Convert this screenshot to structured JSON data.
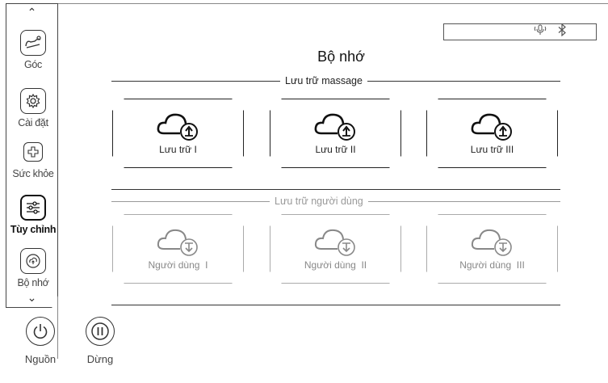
{
  "sidebar": {
    "items": [
      {
        "label": "Góc",
        "icon": "recline-icon"
      },
      {
        "label": "Cài đặt",
        "icon": "gear-icon"
      },
      {
        "label": "Sức khỏe",
        "icon": "health-plus-icon"
      },
      {
        "label": "Tùy chỉnh",
        "icon": "sliders-icon"
      },
      {
        "label": "Bộ nhớ",
        "icon": "memory-cloud-icon"
      }
    ]
  },
  "controls": {
    "power_label": "Nguồn",
    "pause_label": "Dừng"
  },
  "status_bar": {
    "icons": [
      "voice-mic-icon",
      "bluetooth-icon"
    ]
  },
  "page": {
    "title": "Bộ nhớ"
  },
  "storage_section": {
    "label": "Lưu trữ massage",
    "cards": [
      {
        "label": "Lưu trữ I"
      },
      {
        "label": "Lưu trữ II"
      },
      {
        "label": "Lưu trữ III"
      }
    ]
  },
  "user_section": {
    "label": "Lưu trữ người dùng",
    "cards": [
      {
        "label": "Người dùng  I"
      },
      {
        "label": "Người dùng  II"
      },
      {
        "label": "Người dùng  III"
      }
    ]
  },
  "colors": {
    "active": "#222222",
    "disabled": "#999999"
  }
}
